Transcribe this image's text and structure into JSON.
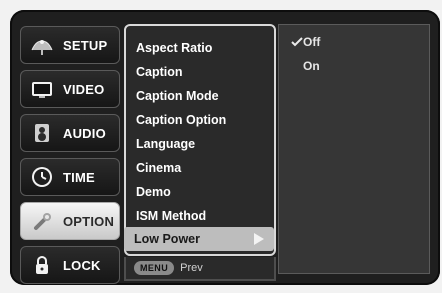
{
  "nav": {
    "items": [
      {
        "label": "SETUP",
        "icon": "satellite-dish-icon"
      },
      {
        "label": "VIDEO",
        "icon": "tv-icon"
      },
      {
        "label": "AUDIO",
        "icon": "speaker-icon"
      },
      {
        "label": "TIME",
        "icon": "clock-icon"
      },
      {
        "label": "OPTION",
        "icon": "wrench-icon"
      },
      {
        "label": "LOCK",
        "icon": "lock-icon"
      }
    ]
  },
  "submenu": {
    "items": [
      {
        "label": "Aspect Ratio"
      },
      {
        "label": "Caption"
      },
      {
        "label": "Caption Mode"
      },
      {
        "label": "Caption Option"
      },
      {
        "label": "Language"
      },
      {
        "label": "Cinema"
      },
      {
        "label": "Demo"
      },
      {
        "label": "ISM Method"
      },
      {
        "label": "Low Power"
      }
    ]
  },
  "panel": {
    "options": [
      "Off",
      "On"
    ],
    "selected": "Off"
  },
  "footer": {
    "menu_label": "MENU",
    "prev_label": "Prev"
  }
}
